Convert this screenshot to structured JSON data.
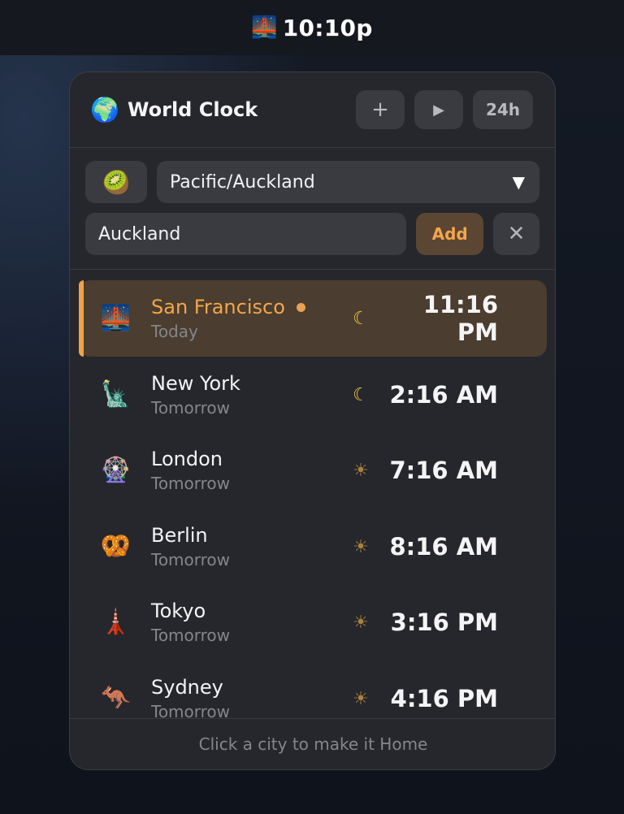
{
  "menubar": {
    "icon": "🌉",
    "time": "10:10p"
  },
  "header": {
    "icon": "🌍",
    "title": "World Clock",
    "add_label": "+",
    "play_label": "▶",
    "format_label": "24h"
  },
  "form": {
    "emoji": "🥝",
    "timezone": "Pacific/Auckland",
    "caret": "▼",
    "city_value": "Auckland",
    "add_label": "Add",
    "cancel_label": "✕"
  },
  "cities": [
    {
      "icon": "🌉",
      "name": "San Francisco",
      "day": "Today",
      "sky": "☾",
      "sky_type": "moon",
      "time": "11:16 PM",
      "home": true
    },
    {
      "icon": "🗽",
      "name": "New York",
      "day": "Tomorrow",
      "sky": "☾",
      "sky_type": "moon",
      "time": "2:16 AM",
      "home": false
    },
    {
      "icon": "🎡",
      "name": "London",
      "day": "Tomorrow",
      "sky": "☀",
      "sky_type": "sun",
      "time": "7:16 AM",
      "home": false
    },
    {
      "icon": "🥨",
      "name": "Berlin",
      "day": "Tomorrow",
      "sky": "☀",
      "sky_type": "sun",
      "time": "8:16 AM",
      "home": false
    },
    {
      "icon": "🗼",
      "name": "Tokyo",
      "day": "Tomorrow",
      "sky": "☀",
      "sky_type": "sun",
      "time": "3:16 PM",
      "home": false
    },
    {
      "icon": "🦘",
      "name": "Sydney",
      "day": "Tomorrow",
      "sky": "☀",
      "sky_type": "sun",
      "time": "4:16 PM",
      "home": false
    }
  ],
  "footer": {
    "hint": "Click a city to make it Home"
  },
  "colors": {
    "accent": "#f2a64d",
    "panel": "#26272c",
    "control": "#3a3b41"
  }
}
